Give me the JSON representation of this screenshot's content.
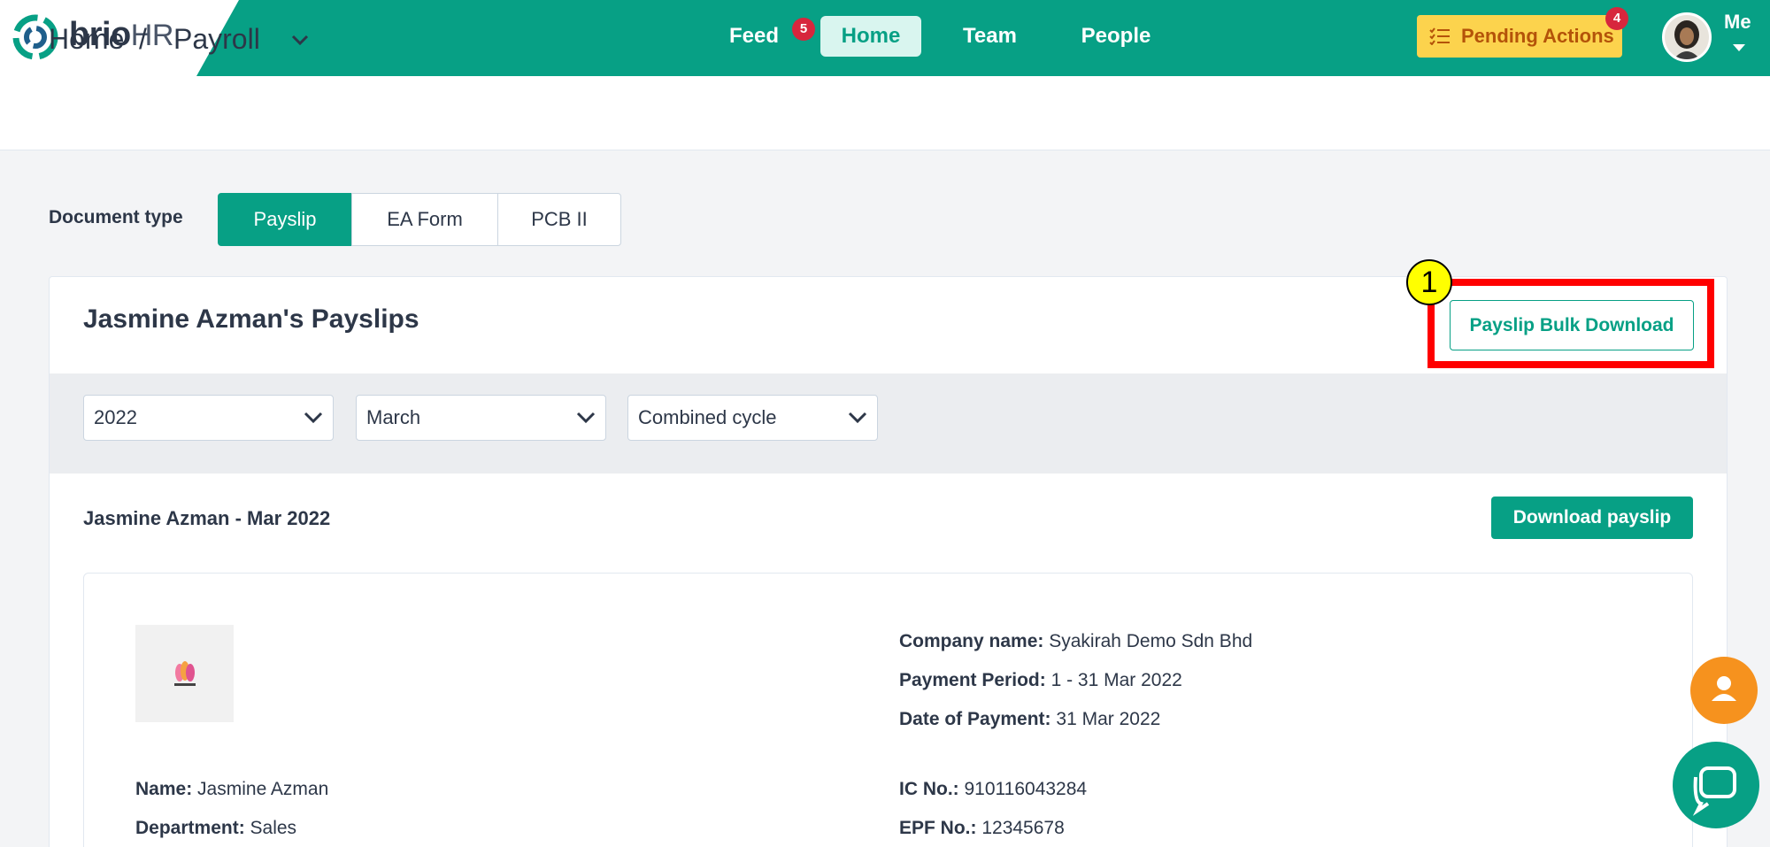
{
  "brand": {
    "name_main": "brio",
    "name_suffix": "HR"
  },
  "nav": {
    "items": [
      {
        "label": "Feed",
        "badge": "5"
      },
      {
        "label": "Home"
      },
      {
        "label": "Team"
      },
      {
        "label": "People"
      }
    ],
    "pending_actions": {
      "label": "Pending Actions",
      "badge": "4"
    },
    "me_label": "Me"
  },
  "breadcrumb": {
    "home": "Home",
    "separator": "/",
    "current": "Payroll"
  },
  "document_type": {
    "label": "Document type",
    "options": [
      "Payslip",
      "EA Form",
      "PCB II"
    ],
    "selected": "Payslip"
  },
  "card": {
    "title": "Jasmine Azman's Payslips",
    "bulk_download_label": "Payslip Bulk Download",
    "annotation_marker": "1"
  },
  "filters": {
    "year": "2022",
    "month": "March",
    "cycle": "Combined cycle"
  },
  "payslip": {
    "period_title": "Jasmine Azman - Mar 2022",
    "download_label": "Download payslip",
    "company_name_label": "Company name:",
    "company_name": "Syakirah Demo Sdn Bhd",
    "payment_period_label": "Payment Period:",
    "payment_period": "1 - 31 Mar 2022",
    "date_of_payment_label": "Date of Payment:",
    "date_of_payment": "31 Mar 2022",
    "name_label": "Name:",
    "name": "Jasmine Azman",
    "department_label": "Department:",
    "department": "Sales",
    "ic_label": "IC No.:",
    "ic": "910116043284",
    "epf_label": "EPF No.:",
    "epf": "12345678"
  },
  "colors": {
    "brand": "#07a085",
    "highlight": "#ff0000",
    "pending": "#fcd34d",
    "badge": "#d7263d"
  }
}
